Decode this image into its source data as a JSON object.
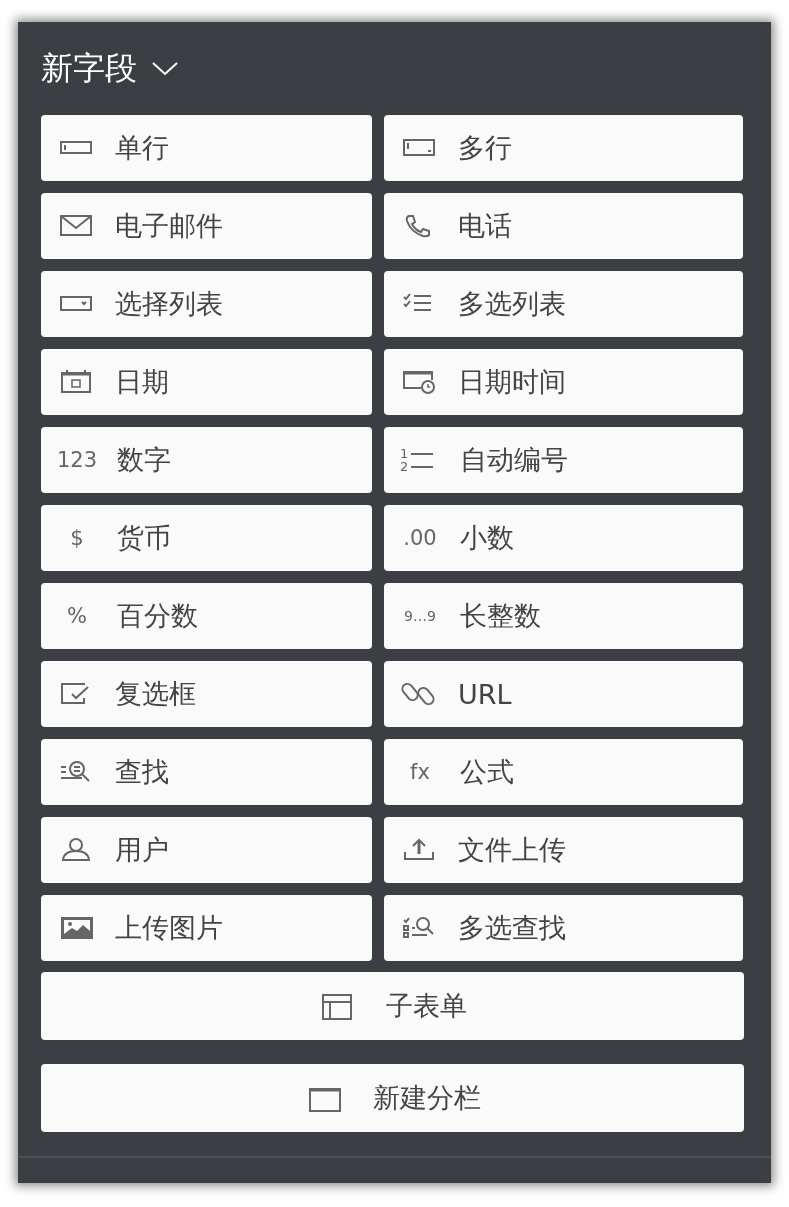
{
  "panel": {
    "title": "新字段"
  },
  "fields": [
    {
      "label": "单行",
      "kind": "single-line"
    },
    {
      "label": "多行",
      "kind": "multi-line"
    },
    {
      "label": "电子邮件",
      "kind": "envelope"
    },
    {
      "label": "电话",
      "kind": "phone"
    },
    {
      "label": "选择列表",
      "kind": "dropdown"
    },
    {
      "label": "多选列表",
      "kind": "checklist"
    },
    {
      "label": "日期",
      "kind": "calendar"
    },
    {
      "label": "日期时间",
      "kind": "calendar-clock"
    },
    {
      "label": "数字",
      "kind": "text",
      "icon_text": "123"
    },
    {
      "label": "自动编号",
      "kind": "numbered",
      "icon_text": [
        "1",
        "2"
      ]
    },
    {
      "label": "货币",
      "kind": "text",
      "icon_text": "$"
    },
    {
      "label": "小数",
      "kind": "text",
      "icon_text": ".00"
    },
    {
      "label": "百分数",
      "kind": "text",
      "icon_text": "%"
    },
    {
      "label": "长整数",
      "kind": "small-text",
      "icon_text": "9…9"
    },
    {
      "label": "复选框",
      "kind": "checkbox"
    },
    {
      "label": "URL",
      "kind": "link"
    },
    {
      "label": "查找",
      "kind": "lookup"
    },
    {
      "label": "公式",
      "kind": "text",
      "icon_text": "fx"
    },
    {
      "label": "用户",
      "kind": "user"
    },
    {
      "label": "文件上传",
      "kind": "upload"
    },
    {
      "label": "上传图片",
      "kind": "image"
    },
    {
      "label": "多选查找",
      "kind": "multi-lookup"
    }
  ],
  "wide_buttons": [
    {
      "label": "子表单",
      "kind": "table"
    },
    {
      "label": "新建分栏",
      "kind": "section"
    }
  ]
}
